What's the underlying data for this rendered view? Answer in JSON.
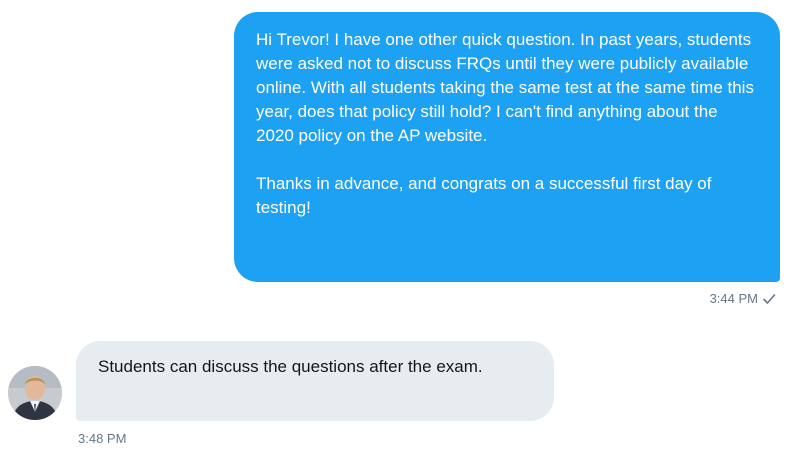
{
  "conversation": {
    "sent_message": {
      "paragraphs": [
        "Hi Trevor! I have one other quick question. In past years, students were asked not to discuss FRQs until they were publicly available online. With all students taking the same test at the same time this year, does that policy still hold? I can't find anything about the 2020 policy on the AP website.",
        "Thanks in advance, and congrats on a successful first day of testing!"
      ],
      "timestamp": "3:44 PM",
      "status_icon": "checkmark-icon"
    },
    "received_message": {
      "text": "Students can discuss the questions after the exam.",
      "timestamp": "3:48 PM",
      "avatar_icon": "user-avatar"
    }
  },
  "colors": {
    "sent_bubble": "#1da1f2",
    "received_bubble": "#e6ecf0",
    "timestamp": "#657786"
  }
}
